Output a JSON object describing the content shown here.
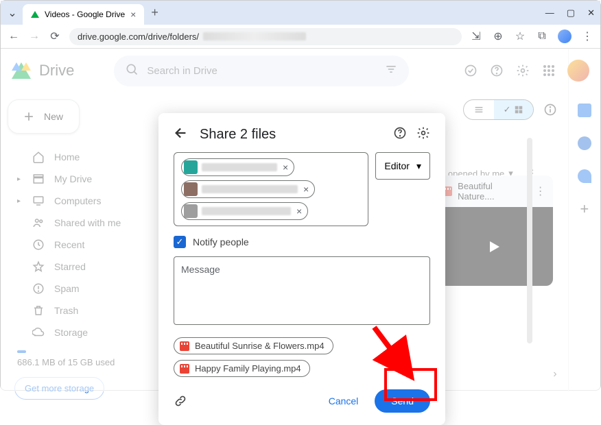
{
  "browser": {
    "tab_title": "Videos - Google Drive",
    "url": "drive.google.com/drive/folders/"
  },
  "drive": {
    "title": "Drive",
    "search_placeholder": "Search in Drive",
    "new_button": "New",
    "nav": {
      "home": "Home",
      "my_drive": "My Drive",
      "computers": "Computers",
      "shared": "Shared with me",
      "recent": "Recent",
      "starred": "Starred",
      "spam": "Spam",
      "trash": "Trash",
      "storage": "Storage"
    },
    "storage_used": "686.1 MB of 15 GB used",
    "get_more": "Get more storage"
  },
  "main": {
    "sort_label": "Last opened by me",
    "preview_title": "Beautiful Nature...."
  },
  "modal": {
    "title": "Share 2 files",
    "role": "Editor",
    "notify": "Notify people",
    "msg_placeholder": "Message",
    "files": [
      "Beautiful Sunrise & Flowers.mp4",
      "Happy Family Playing.mp4"
    ],
    "cancel": "Cancel",
    "send": "Send"
  }
}
